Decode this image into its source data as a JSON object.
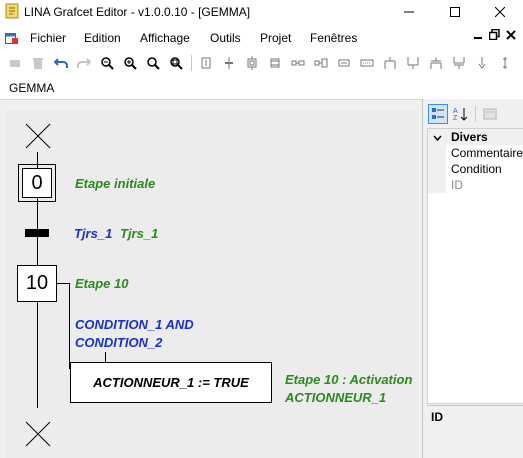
{
  "window": {
    "title": "LINA Grafcet Editor - v1.0.0.10 - [GEMMA]"
  },
  "menu": {
    "items": [
      "Fichier",
      "Edition",
      "Affichage",
      "Outils",
      "Projet",
      "Fenêtres"
    ]
  },
  "tab": {
    "label": "GEMMA"
  },
  "grafcet": {
    "initial_step": {
      "number": "0",
      "label": "Etape initiale"
    },
    "transition": {
      "name": "Tjrs_1",
      "condition": "Tjrs_1"
    },
    "step": {
      "number": "10",
      "label": "Etape 10"
    },
    "action_condition": {
      "line1": "CONDITION_1 AND",
      "line2": "CONDITION_2"
    },
    "action": {
      "text": "ACTIONNEUR_1 := TRUE"
    },
    "action_comment": {
      "line1": "Etape 10 : Activation",
      "line2": "ACTIONNEUR_1"
    }
  },
  "properties": {
    "category": "Divers",
    "rows": [
      "Commentaire",
      "Condition",
      "ID"
    ],
    "description_title": "ID"
  },
  "colors": {
    "green": "#2a8a1c",
    "blue": "#1a2fd0"
  }
}
